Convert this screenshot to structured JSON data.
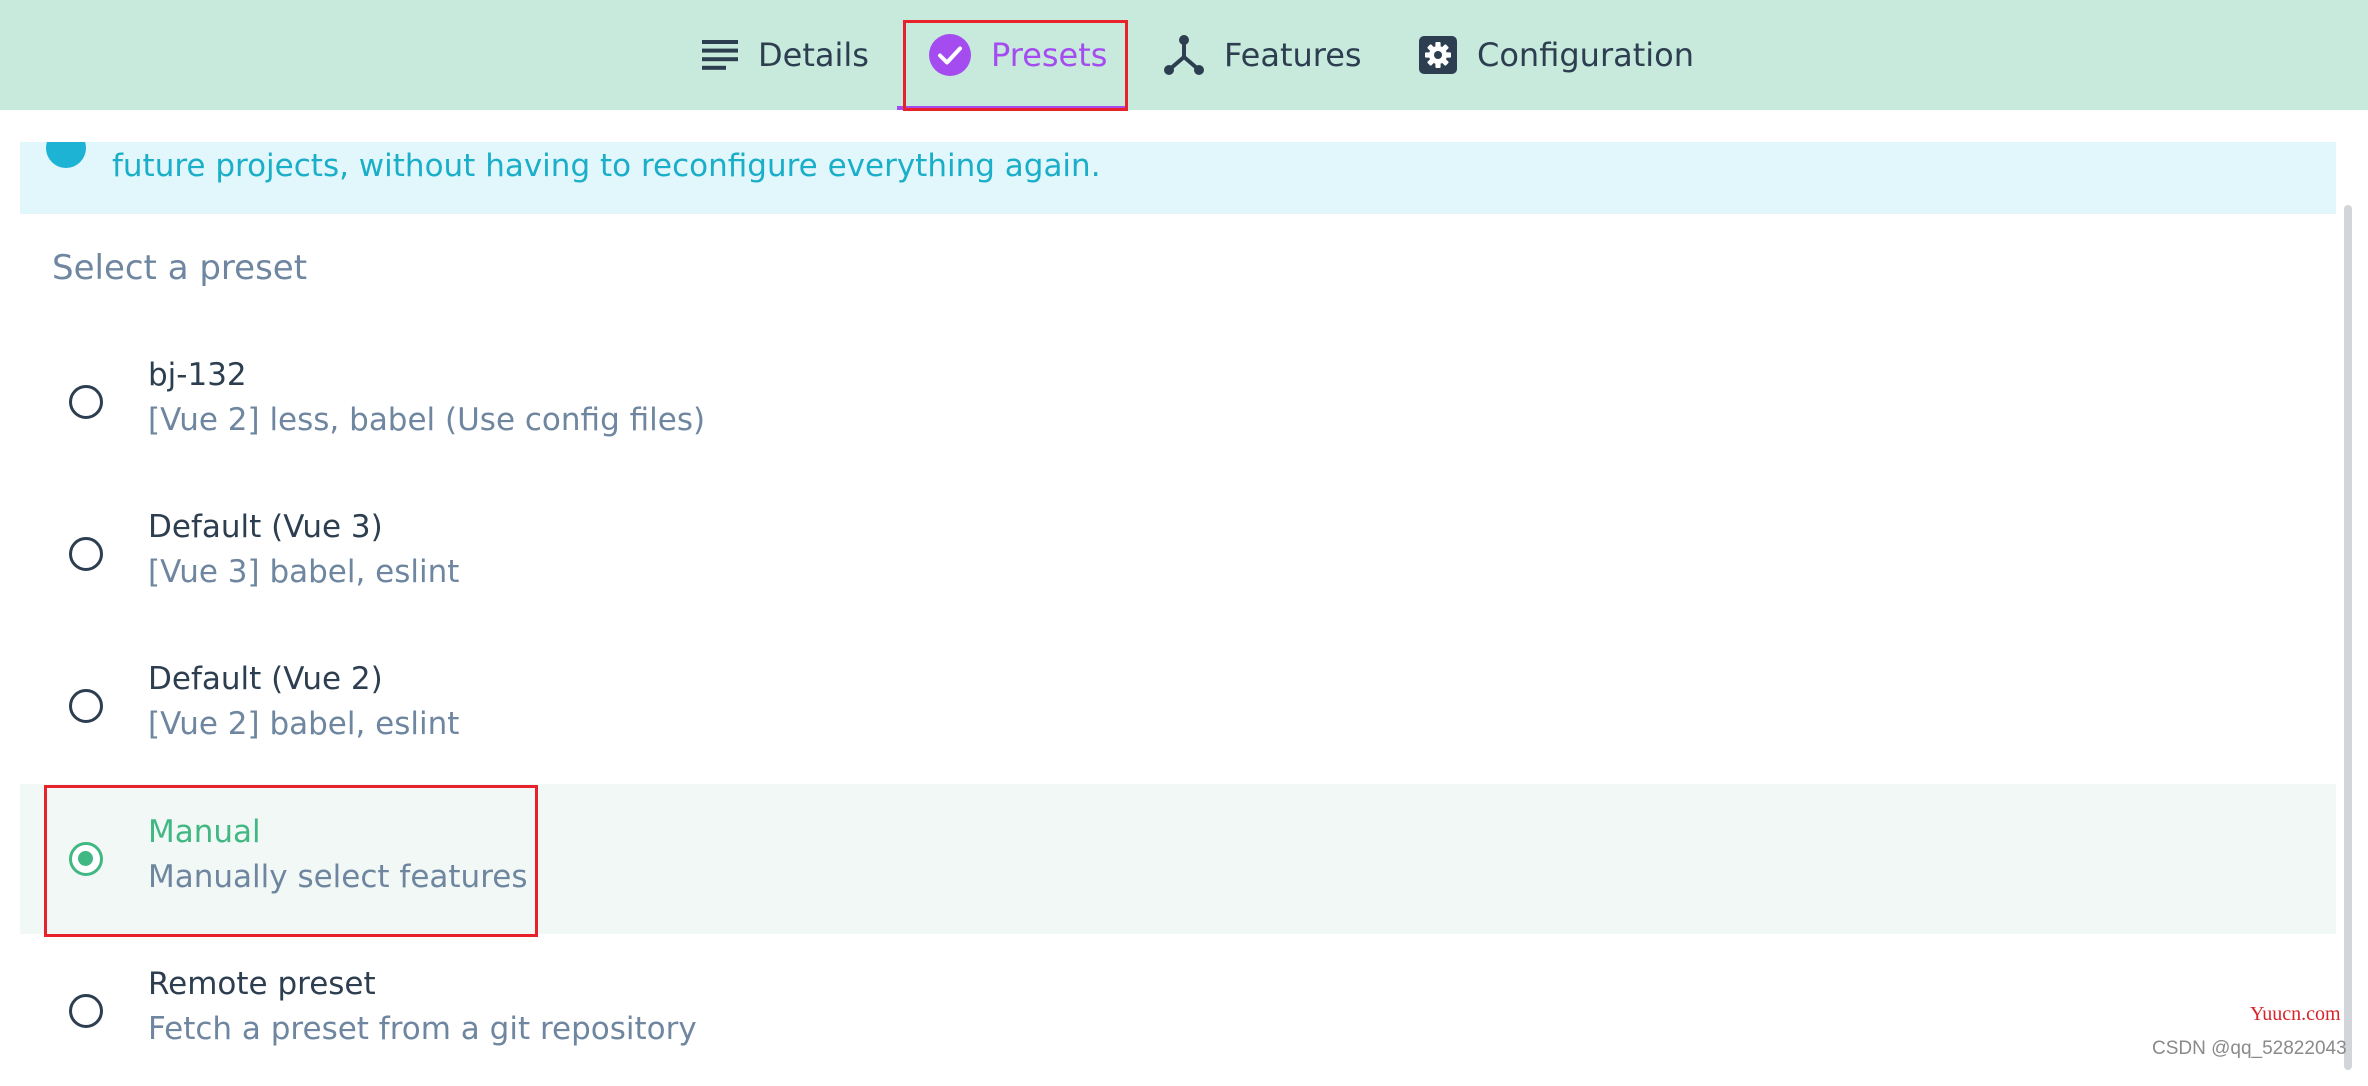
{
  "tabs": [
    {
      "label": "Details",
      "icon": "list-icon",
      "active": false
    },
    {
      "label": "Presets",
      "icon": "check-circle-icon",
      "active": true
    },
    {
      "label": "Features",
      "icon": "fork-icon",
      "active": false
    },
    {
      "label": "Configuration",
      "icon": "gear-icon",
      "active": false
    }
  ],
  "info_banner": {
    "text": "future projects, without having to reconfigure everything again."
  },
  "preset_section": {
    "heading": "Select a preset",
    "presets": [
      {
        "title": "bj-132",
        "description": "[Vue 2] less, babel (Use config files)",
        "selected": false
      },
      {
        "title": "Default (Vue 3)",
        "description": "[Vue 3] babel, eslint",
        "selected": false
      },
      {
        "title": "Default (Vue 2)",
        "description": "[Vue 2] babel, eslint",
        "selected": false
      },
      {
        "title": "Manual",
        "description": "Manually select features",
        "selected": true
      },
      {
        "title": "Remote preset",
        "description": "Fetch a preset from a git repository",
        "selected": false
      }
    ]
  },
  "watermark": {
    "site": "Yuucn.com",
    "credit": "CSDN @qq_52822043"
  },
  "colors": {
    "tab_bar_bg": "#c7eadc",
    "active_tab": "#a44cf0",
    "selected_accent": "#41b883",
    "info_text": "#1aaec9",
    "highlight_box": "#e8222a"
  }
}
